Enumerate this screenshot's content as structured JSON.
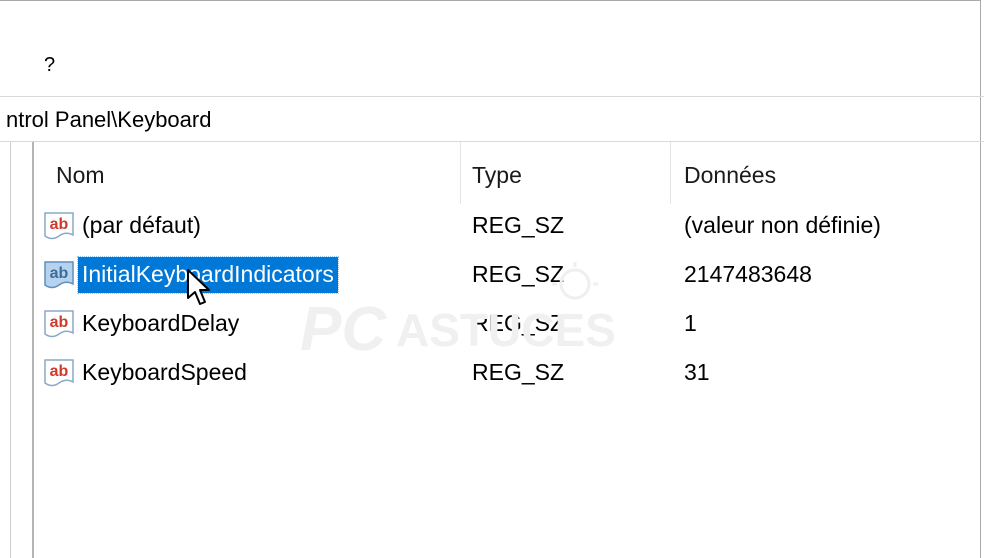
{
  "menu": {
    "help_label": "?"
  },
  "address": {
    "path": "ntrol Panel\\Keyboard"
  },
  "list": {
    "columns": {
      "name": "Nom",
      "type": "Type",
      "data": "Données"
    },
    "rows": [
      {
        "name": "(par défaut)",
        "type": "REG_SZ",
        "data": "(valeur non définie)"
      },
      {
        "name": "InitialKeyboardIndicators",
        "type": "REG_SZ",
        "data": "2147483648",
        "selected": true
      },
      {
        "name": "KeyboardDelay",
        "type": "REG_SZ",
        "data": "1"
      },
      {
        "name": "KeyboardSpeed",
        "type": "REG_SZ",
        "data": "31"
      }
    ]
  },
  "icons": {
    "row_icon": "string-value-icon",
    "cursor": "mouse-pointer-icon"
  },
  "colors": {
    "selection": "#0078d7",
    "icon_red": "#d03a2c",
    "icon_paper": "#b6d3ee"
  }
}
